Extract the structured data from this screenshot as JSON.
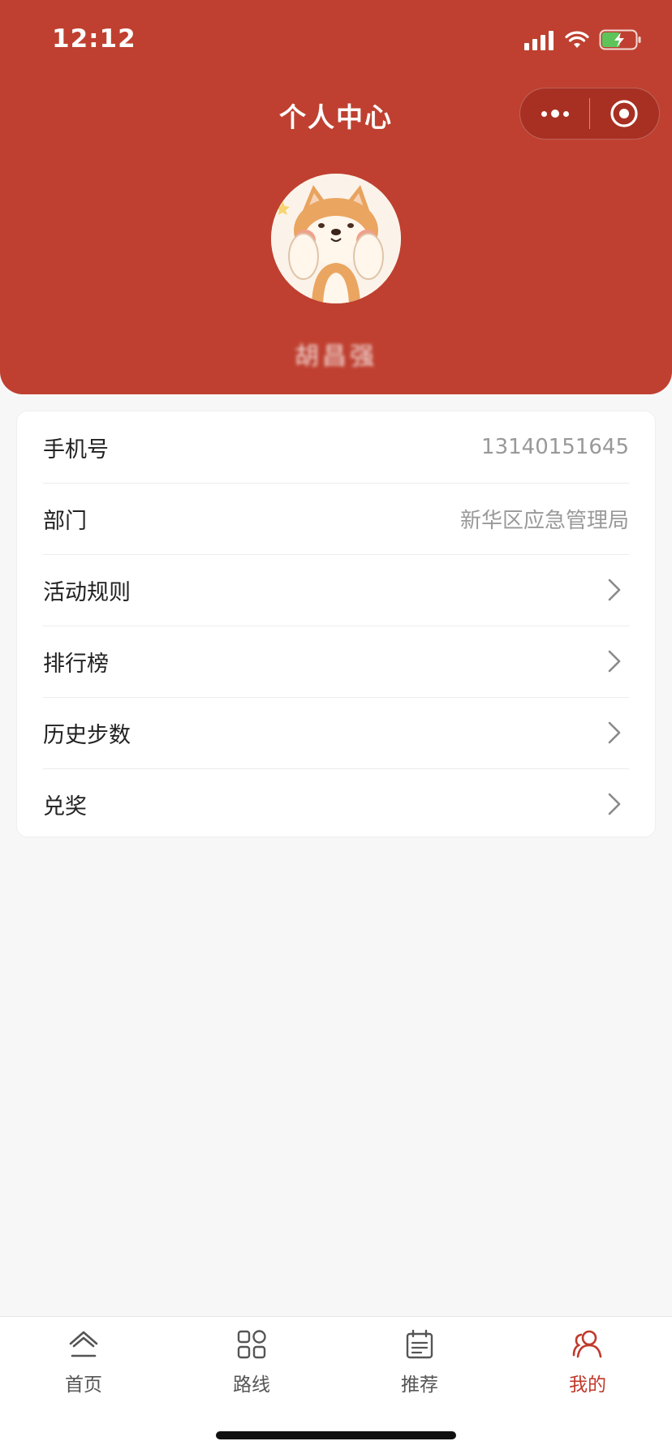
{
  "status_bar": {
    "time": "12:12"
  },
  "nav": {
    "title": "个人中心"
  },
  "profile": {
    "username": "胡昌强"
  },
  "info": {
    "phone": {
      "label": "手机号",
      "value": "13140151645"
    },
    "department": {
      "label": "部门",
      "value": "新华区应急管理局"
    }
  },
  "menu": [
    {
      "label": "活动规则"
    },
    {
      "label": "排行榜"
    },
    {
      "label": "历史步数"
    },
    {
      "label": "兑奖"
    }
  ],
  "tabbar": {
    "items": [
      {
        "label": "首页",
        "icon": "home-icon"
      },
      {
        "label": "路线",
        "icon": "grid-icon"
      },
      {
        "label": "推荐",
        "icon": "calendar-icon"
      },
      {
        "label": "我的",
        "icon": "user-icon"
      }
    ],
    "active_index": 3
  },
  "colors": {
    "brand": "#bf4030",
    "active_tab": "#c0392b",
    "muted_text": "#999999"
  }
}
